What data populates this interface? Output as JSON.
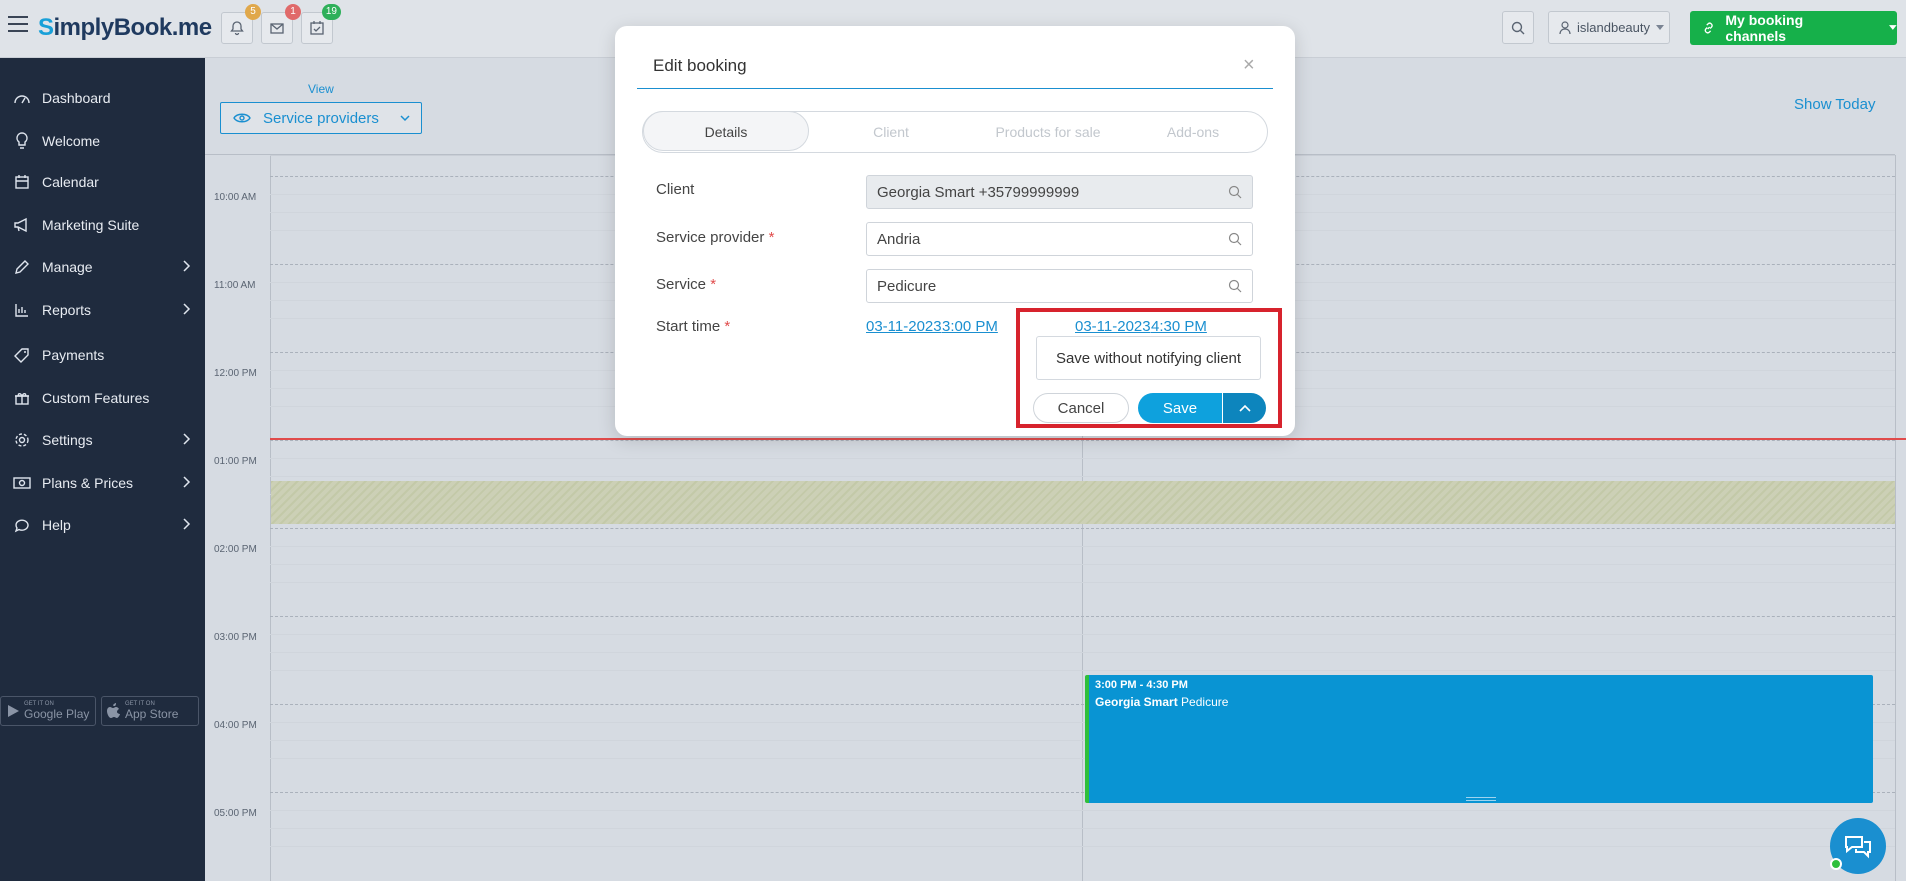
{
  "topbar": {
    "logo_s": "S",
    "logo_rest": "implyBook",
    "logo_me": ".me",
    "notifications_count": "5",
    "messages_count": "1",
    "tasks_count": "19",
    "username": "islandbeauty",
    "booking_channels_label": "My booking channels"
  },
  "sidebar": {
    "items": [
      {
        "label": "Dashboard",
        "icon": "gauge-icon"
      },
      {
        "label": "Welcome",
        "icon": "lightbulb-icon"
      },
      {
        "label": "Calendar",
        "icon": "calendar-icon"
      },
      {
        "label": "Marketing Suite",
        "icon": "megaphone-icon"
      },
      {
        "label": "Manage",
        "icon": "pencil-icon"
      },
      {
        "label": "Reports",
        "icon": "bar-chart-icon"
      },
      {
        "label": "Payments",
        "icon": "tag-icon"
      },
      {
        "label": "Custom Features",
        "icon": "gift-icon"
      },
      {
        "label": "Settings",
        "icon": "gear-icon"
      },
      {
        "label": "Plans & Prices",
        "icon": "money-icon"
      },
      {
        "label": "Help",
        "icon": "chat-icon"
      }
    ],
    "google_play_small": "GET IT ON",
    "google_play": "Google Play",
    "app_store_small": "GET IT ON",
    "app_store": "App Store"
  },
  "main": {
    "view_label": "View",
    "view_value": "Service providers",
    "show_today": "Show Today",
    "time_labels": [
      "10:00 AM",
      "11:00 AM",
      "12:00 PM",
      "01:00 PM",
      "02:00 PM",
      "03:00 PM",
      "04:00 PM",
      "05:00 PM"
    ],
    "booking": {
      "time": "3:00 PM - 4:30 PM",
      "client": "Georgia Smart",
      "service": "Pedicure"
    }
  },
  "modal": {
    "title": "Edit booking",
    "close": "×",
    "tabs": [
      "Details",
      "Client",
      "Products for sale",
      "Add-ons"
    ],
    "fields": {
      "client_label": "Client",
      "client_value": "Georgia Smart +35799999999",
      "provider_label": "Service provider",
      "provider_value": "Andria",
      "service_label": "Service",
      "service_value": "Pedicure",
      "start_label": "Start time",
      "required_mark": "*",
      "start_date": "03-11-2023",
      "start_time": "3:00 PM",
      "end_date": "03-11-2023",
      "end_time": "4:30 PM"
    },
    "save_without_notify": "Save without notifying client",
    "cancel": "Cancel",
    "save": "Save"
  },
  "colors": {
    "accent": "#1a8fd0",
    "brand_green": "#16b04a",
    "sidebar_bg": "#1f2b3e",
    "booking_blue": "#0994d3",
    "highlight_red": "#d7232d"
  }
}
